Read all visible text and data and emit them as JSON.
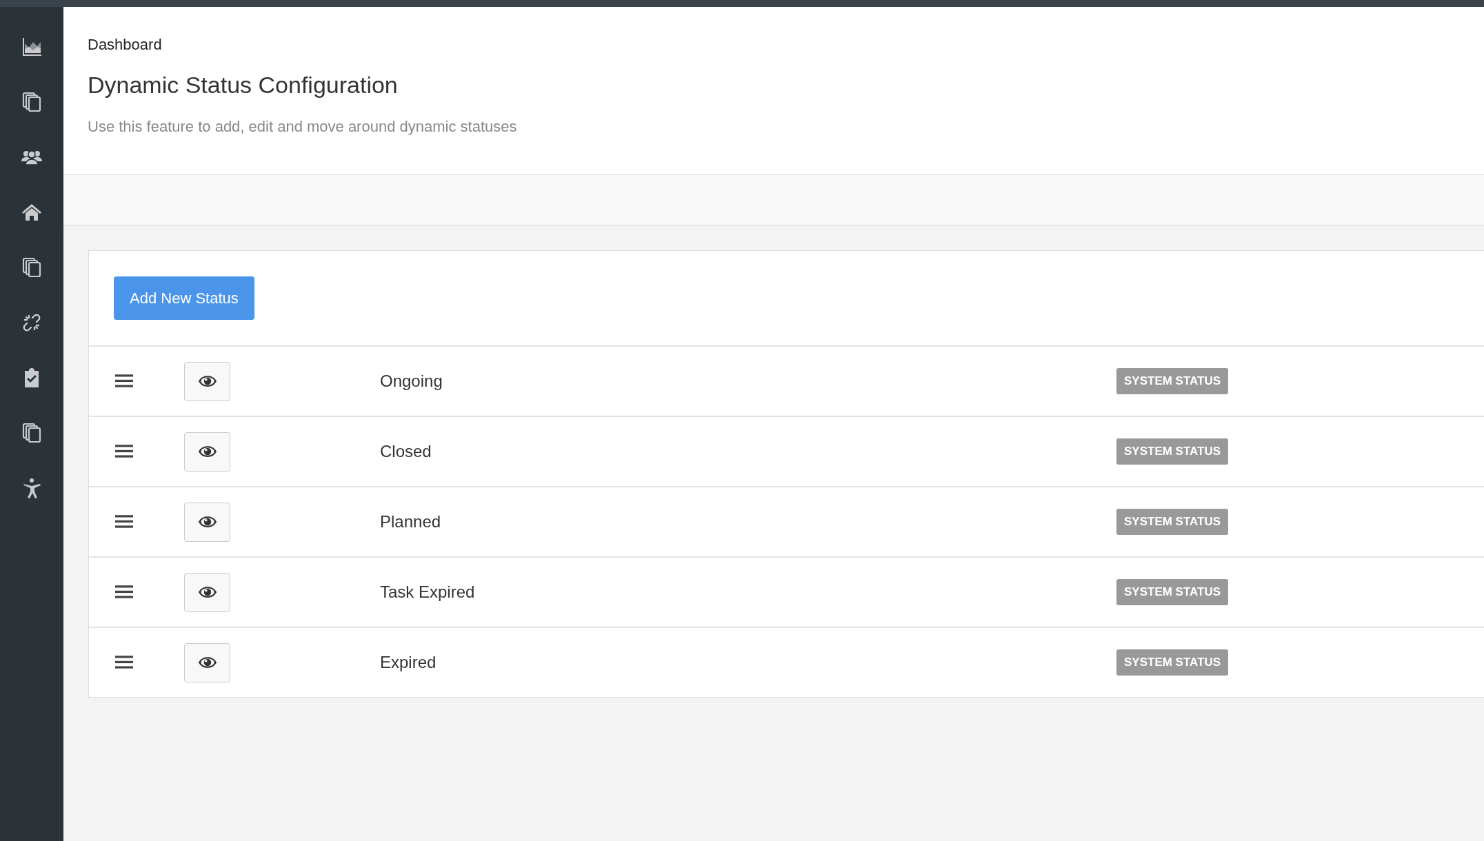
{
  "breadcrumb": "Dashboard",
  "title": "Dynamic Status Configuration",
  "subtitle": "Use this feature to add, edit and move around dynamic statuses",
  "add_button": "Add New Status",
  "statuses": [
    {
      "name": "Ongoing",
      "badge": "SYSTEM STATUS"
    },
    {
      "name": "Closed",
      "badge": "SYSTEM STATUS"
    },
    {
      "name": "Planned",
      "badge": "SYSTEM STATUS"
    },
    {
      "name": "Task Expired",
      "badge": "SYSTEM STATUS"
    },
    {
      "name": "Expired",
      "badge": "SYSTEM STATUS"
    }
  ]
}
